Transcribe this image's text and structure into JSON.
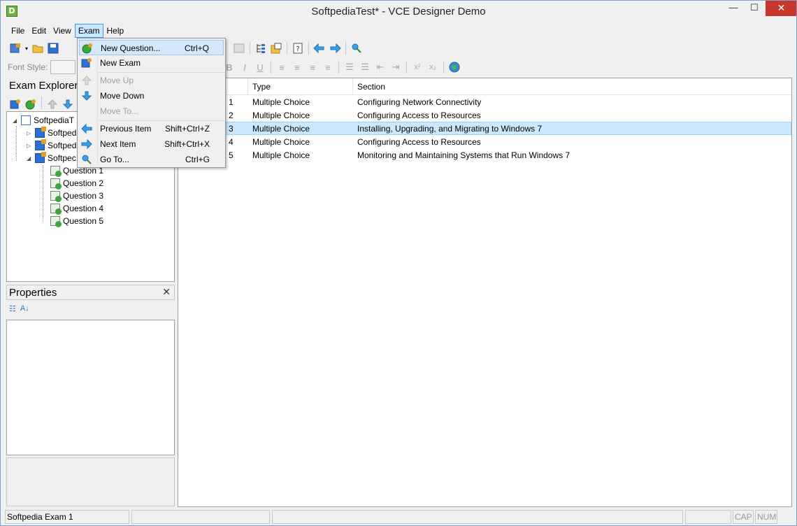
{
  "window": {
    "title": "SoftpediaTest* - VCE Designer Demo",
    "app_icon_letter": "D",
    "min_glyph": "—",
    "max_glyph": "☐",
    "close_glyph": "✕"
  },
  "menubar": {
    "file": "File",
    "edit": "Edit",
    "view": "View",
    "exam": "Exam",
    "help": "Help"
  },
  "toolbar": {
    "font_style_label": "Font Style:",
    "bold": "B",
    "italic": "I",
    "underline": "U",
    "superscript": "x²",
    "subscript": "x₂"
  },
  "exam_menu": {
    "items": [
      {
        "label": "New Question...",
        "shortcut": "Ctrl+Q",
        "icon": "new-question-icon",
        "enabled": true
      },
      {
        "label": "New Exam",
        "shortcut": "",
        "icon": "new-exam-icon",
        "enabled": true
      },
      {
        "label": "Move Up",
        "shortcut": "",
        "icon": "arrow-up-icon",
        "enabled": false
      },
      {
        "label": "Move Down",
        "shortcut": "",
        "icon": "arrow-down-icon",
        "enabled": true
      },
      {
        "label": "Move To...",
        "shortcut": "",
        "icon": "",
        "enabled": false
      },
      {
        "label": "Previous Item",
        "shortcut": "Shift+Ctrl+Z",
        "icon": "previous-item-icon",
        "enabled": true
      },
      {
        "label": "Next Item",
        "shortcut": "Shift+Ctrl+X",
        "icon": "next-item-icon",
        "enabled": true
      },
      {
        "label": "Go To...",
        "shortcut": "Ctrl+G",
        "icon": "goto-icon",
        "enabled": true
      }
    ]
  },
  "explorer": {
    "title": "Exam Explorer",
    "root": "SoftpediaT",
    "exams": [
      "Softped",
      "Softped",
      "Softpec"
    ],
    "questions": [
      "Question 1",
      "Question 2",
      "Question 3",
      "Question 4",
      "Question 5"
    ]
  },
  "properties": {
    "title": "Properties",
    "close_glyph": "✕",
    "categorized_glyph": "☷",
    "alpha_glyph": "A↓"
  },
  "list": {
    "columns": {
      "type": "Type",
      "section": "Section"
    },
    "rows": [
      {
        "name_tail": "1",
        "type": "Multiple Choice",
        "section": "Configuring Network Connectivity",
        "selected": false
      },
      {
        "name_tail": "2",
        "type": "Multiple Choice",
        "section": "Configuring Access to Resources",
        "selected": false
      },
      {
        "name_tail": "3",
        "type": "Multiple Choice",
        "section": "Installing, Upgrading, and Migrating to Windows 7",
        "selected": true
      },
      {
        "name_tail": "4",
        "type": "Multiple Choice",
        "section": "Configuring Access to Resources",
        "selected": false
      },
      {
        "name_tail": "5",
        "type": "Multiple Choice",
        "section": "Monitoring and Maintaining Systems that Run Windows 7",
        "selected": false
      }
    ]
  },
  "statusbar": {
    "left": "Softpedia Exam 1",
    "cap": "CAP",
    "num": "NUM"
  }
}
